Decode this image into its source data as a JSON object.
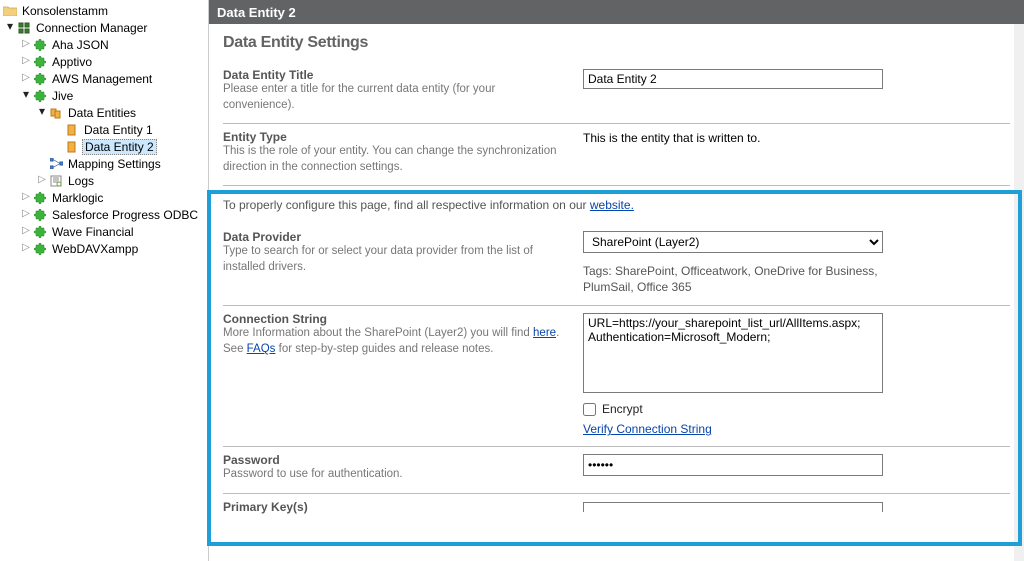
{
  "tree": {
    "root": "Konsolenstamm",
    "connection_manager": "Connection Manager",
    "items": {
      "aha": "Aha JSON",
      "apptivo": "Apptivo",
      "aws": "AWS Management",
      "jive": "Jive",
      "data_entities": "Data Entities",
      "de1": "Data Entity 1",
      "de2": "Data Entity 2",
      "mapping": "Mapping Settings",
      "logs": "Logs",
      "marklogic": "Marklogic",
      "salesforce": "Salesforce Progress ODBC",
      "wave": "Wave Financial",
      "webdav": "WebDAVXampp"
    }
  },
  "header": {
    "title": "Data Entity 2"
  },
  "page": {
    "title": "Data Entity Settings"
  },
  "sections": {
    "title": {
      "label": "Data Entity Title",
      "desc": "Please enter a title for the current data entity (for your convenience).",
      "value": "Data Entity 2"
    },
    "entity_type": {
      "label": "Entity Type",
      "desc": "This is the role of your entity. You can change the synchronization direction in the connection settings.",
      "value": "This is the entity that is written to."
    },
    "info": {
      "text_pre": "To properly configure this page, find all respective information on our ",
      "link": "website."
    },
    "provider": {
      "label": "Data Provider",
      "desc": "Type to search for or select your data provider from the list of installed drivers.",
      "value": "SharePoint (Layer2)",
      "tags": "Tags: SharePoint, Officeatwork, OneDrive for Business, PlumSail, Office 365"
    },
    "connstr": {
      "label": "Connection String",
      "desc_pre": "More Information about the SharePoint (Layer2) you will find ",
      "desc_here": "here",
      "desc_mid": ". See ",
      "desc_faq": "FAQs",
      "desc_post": " for step-by-step guides and release notes.",
      "value": "URL=https://your_sharepoint_list_url/AllItems.aspx;\nAuthentication=Microsoft_Modern;",
      "encrypt": "Encrypt",
      "verify": "Verify Connection String"
    },
    "password": {
      "label": "Password",
      "desc": "Password to use for authentication.",
      "value": "••••••"
    },
    "primary": {
      "label": "Primary Key(s)"
    }
  }
}
